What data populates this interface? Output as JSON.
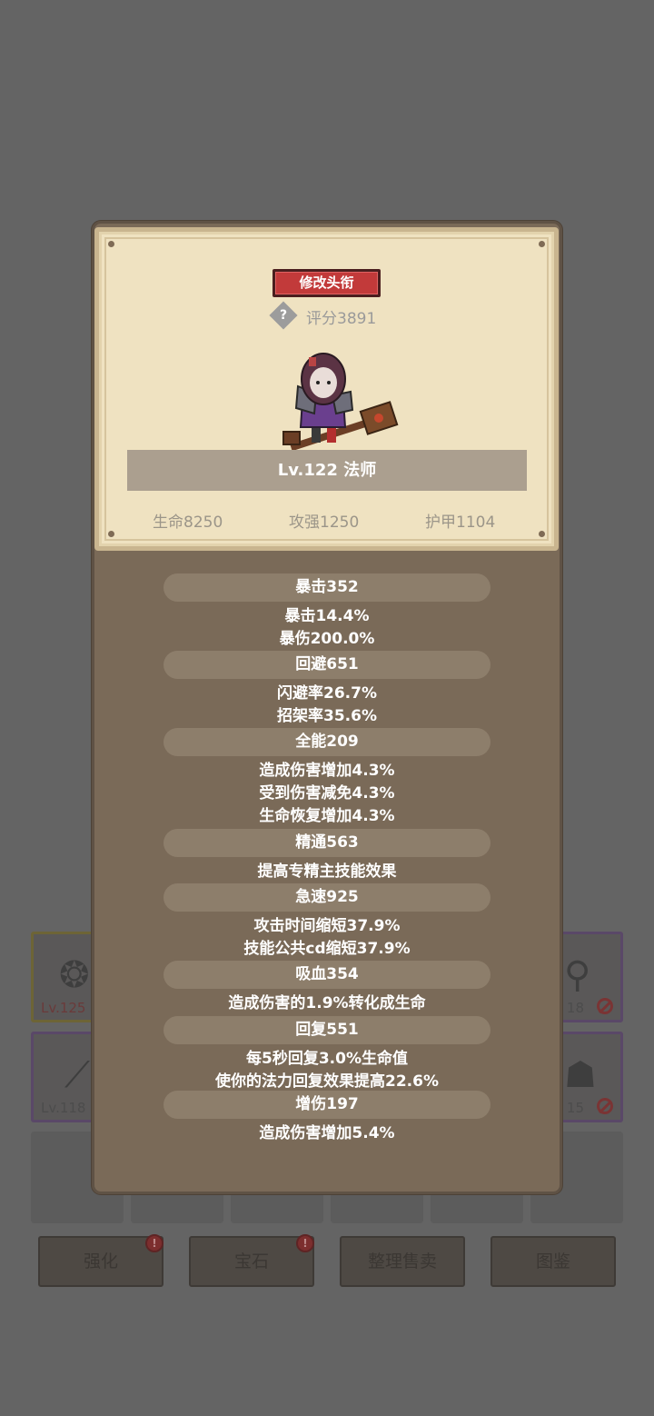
{
  "header": {
    "edit_title_button": "修改头衔",
    "help_glyph": "?",
    "score": "评分3891"
  },
  "hero": {
    "level_class": "Lv.122 法师",
    "hp": "生命8250",
    "attack": "攻强1250",
    "armor": "护甲1104"
  },
  "attributes": [
    {
      "head": "暴击352",
      "lines": [
        "暴击14.4%",
        "暴伤200.0%"
      ]
    },
    {
      "head": "回避651",
      "lines": [
        "闪避率26.7%",
        "招架率35.6%"
      ]
    },
    {
      "head": "全能209",
      "lines": [
        "造成伤害增加4.3%",
        "受到伤害减免4.3%",
        "生命恢复增加4.3%"
      ]
    },
    {
      "head": "精通563",
      "lines": [
        "提高专精主技能效果"
      ]
    },
    {
      "head": "急速925",
      "lines": [
        "攻击时间缩短37.9%",
        "技能公共cd缩短37.9%"
      ]
    },
    {
      "head": "吸血354",
      "lines": [
        "造成伤害的1.9%转化成生命"
      ]
    },
    {
      "head": "回复551",
      "lines": [
        "每5秒回复3.0%生命值",
        "使你的法力回复效果提高22.6%"
      ]
    },
    {
      "head": "增伤197",
      "lines": [
        "造成伤害增加5.4%"
      ]
    }
  ],
  "background": {
    "slots": [
      {
        "level": "Lv.125"
      },
      {
        "level": "18"
      },
      {
        "level": "Lv.118"
      },
      {
        "level": "15"
      }
    ],
    "buttons": [
      "强化",
      "宝石",
      "整理售卖",
      "图鉴"
    ],
    "notify_glyph": "!"
  },
  "colors": {
    "title_button": "#c23a3a",
    "parchment": "#efe2c1",
    "panel": "#7a6a58",
    "attr_pill": "#8d7e6b"
  }
}
